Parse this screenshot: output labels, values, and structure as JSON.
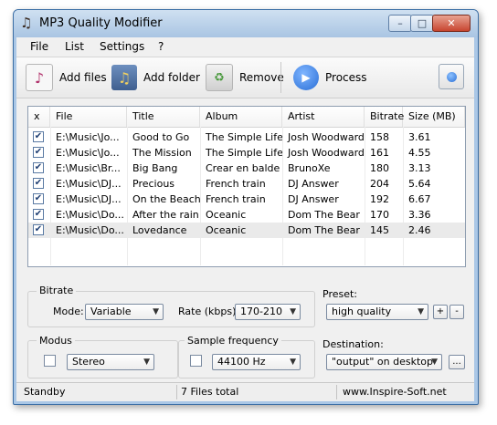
{
  "window": {
    "title": "MP3 Quality Modifier",
    "icon": "music-note-icon"
  },
  "title_buttons": {
    "minimize": "–",
    "maximize": "□",
    "close": "✕"
  },
  "menu": [
    "File",
    "List",
    "Settings",
    "?"
  ],
  "toolbar": {
    "add_files": "Add files",
    "add_folder": "Add folder",
    "remove": "Remove",
    "process": "Process"
  },
  "list": {
    "columns": [
      "x",
      "File",
      "Title",
      "Album",
      "Artist",
      "Bitrate",
      "Size (MB)"
    ],
    "rows": [
      {
        "checked": true,
        "file": "E:\\Music\\Jo...",
        "title": "Good to Go",
        "album": "The Simple Life",
        "artist": "Josh Woodward",
        "bitrate": "158",
        "size": "3.61"
      },
      {
        "checked": true,
        "file": "E:\\Music\\Jo...",
        "title": "The Mission",
        "album": "The Simple Life",
        "artist": "Josh Woodward",
        "bitrate": "161",
        "size": "4.55"
      },
      {
        "checked": true,
        "file": "E:\\Music\\Br...",
        "title": "Big Bang",
        "album": "Crear en balde",
        "artist": "BrunoXe",
        "bitrate": "180",
        "size": "3.13"
      },
      {
        "checked": true,
        "file": "E:\\Music\\DJ...",
        "title": "Precious",
        "album": "French train",
        "artist": "DJ Answer",
        "bitrate": "204",
        "size": "5.64"
      },
      {
        "checked": true,
        "file": "E:\\Music\\DJ...",
        "title": "On the Beach",
        "album": "French train",
        "artist": "DJ Answer",
        "bitrate": "192",
        "size": "6.67"
      },
      {
        "checked": true,
        "file": "E:\\Music\\Do...",
        "title": "After the rain",
        "album": "Oceanic",
        "artist": "Dom The Bear",
        "bitrate": "170",
        "size": "3.36"
      },
      {
        "checked": true,
        "file": "E:\\Music\\Do...",
        "title": "Lovedance",
        "album": "Oceanic",
        "artist": "Dom The Bear",
        "bitrate": "145",
        "size": "2.46"
      }
    ]
  },
  "bitrate": {
    "group_label": "Bitrate",
    "mode_label": "Mode:",
    "mode_value": "Variable",
    "rate_label": "Rate (kbps):",
    "rate_value": "170-210"
  },
  "preset": {
    "label": "Preset:",
    "value": "high quality",
    "add": "+",
    "remove": "-"
  },
  "modus": {
    "label": "Modus",
    "value": "Stereo",
    "checked": false
  },
  "sample": {
    "label": "Sample frequency",
    "value": "44100 Hz",
    "checked": false
  },
  "destination": {
    "label": "Destination:",
    "value": "\"output\" on desktop",
    "browse": "..."
  },
  "status": {
    "state": "Standby",
    "files": "7 Files total",
    "site": "www.Inspire-Soft.net"
  },
  "colors": {
    "title_gradient": "#a9c5e3",
    "frame_border": "#3b6ea5",
    "process_blue": "#2a6fd6"
  }
}
